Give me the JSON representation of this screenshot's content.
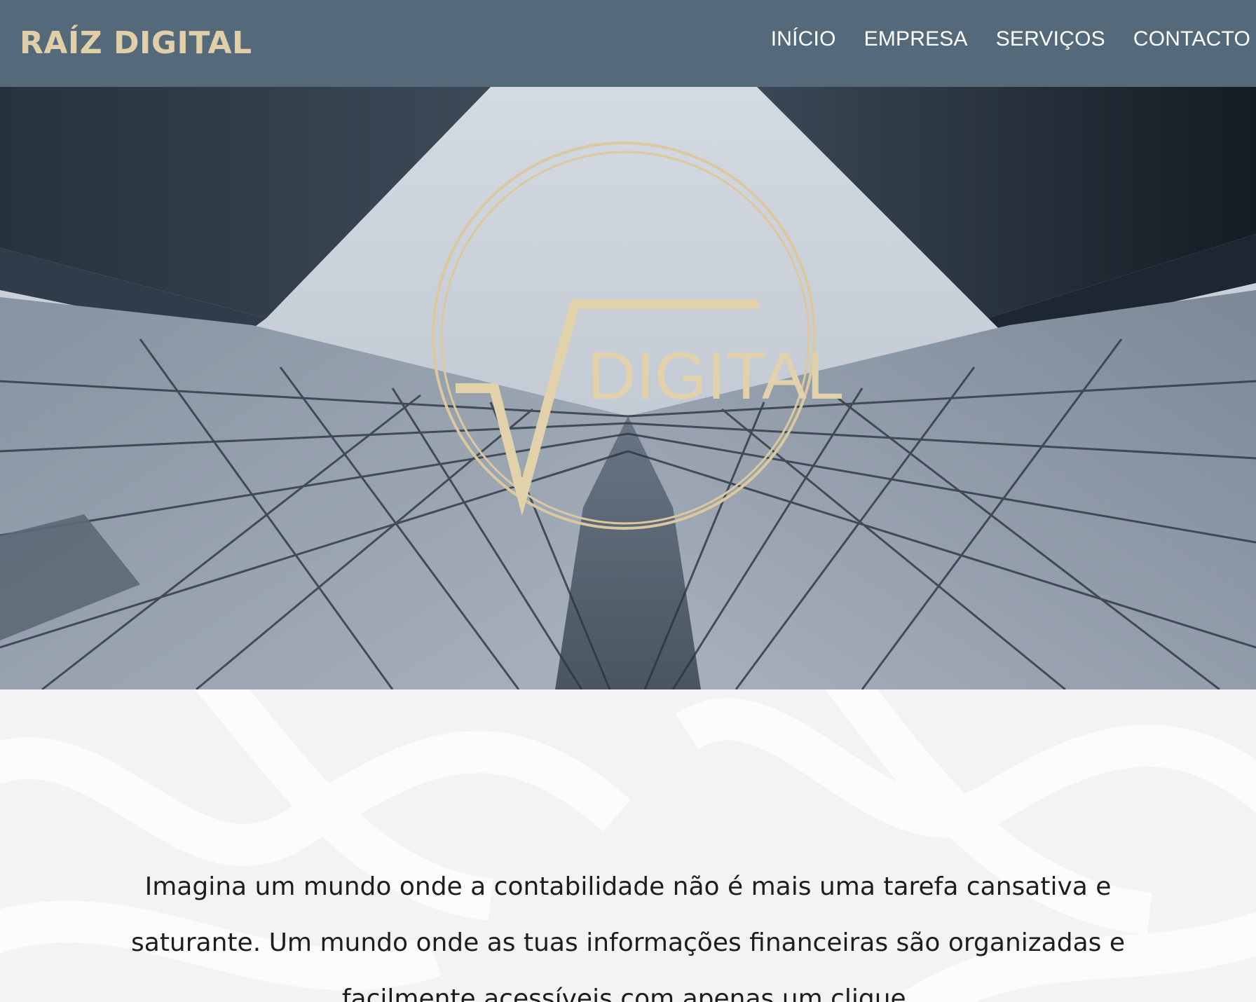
{
  "header": {
    "brand": "RAÍZ DIGITAL",
    "nav": [
      "INÍCIO",
      "EMPRESA",
      "SERVIÇOS",
      "CONTACTO"
    ]
  },
  "hero": {
    "logo_text": "DIGITAL"
  },
  "intro": {
    "text": "Imagina um mundo onde a contabilidade não é mais uma tarefa cansativa e saturante. Um mundo onde as tuas informações financeiras são organizadas e facilmente acessíveis com apenas um clique."
  },
  "colors": {
    "header_bg": "#546a7b",
    "brand_gold": "#e0cfa8",
    "nav_text": "#ffffff",
    "intro_bg": "#f3f3f4",
    "body_text": "#1d1d1d"
  }
}
